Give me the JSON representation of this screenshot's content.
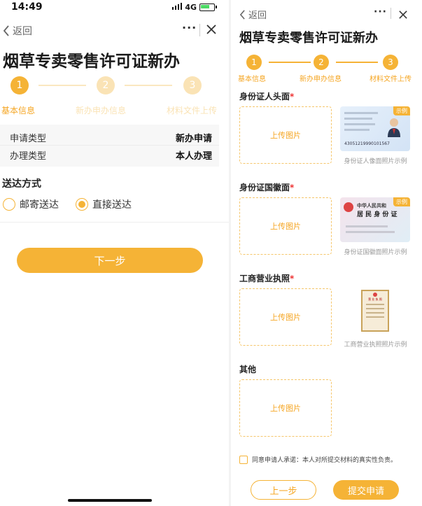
{
  "status_bar": {
    "time": "14:49",
    "network": "4G"
  },
  "nav": {
    "back_label": "返回"
  },
  "page_title": "烟草专卖零售许可证新办",
  "steps": [
    {
      "number": "1",
      "label": "基本信息"
    },
    {
      "number": "2",
      "label": "新办申办信息"
    },
    {
      "number": "3",
      "label": "材料文件上传"
    }
  ],
  "info": [
    {
      "key": "申请类型",
      "value": "新办申请"
    },
    {
      "key": "办理类型",
      "value": "本人办理"
    }
  ],
  "delivery": {
    "title": "送达方式",
    "options": [
      "邮寄送达",
      "直接送达"
    ],
    "selected": "直接送达"
  },
  "next_button": "下一步",
  "uploads": [
    {
      "label": "身份证人头面",
      "required_mark": "*",
      "upload_text": "上传图片",
      "sample_caption": "身份证人像面照片示例",
      "badge": "示例"
    },
    {
      "label": "身份证国徽面",
      "required_mark": "*",
      "upload_text": "上传图片",
      "sample_caption": "身份证国徽面照片示例",
      "badge": "示例"
    },
    {
      "label": "工商营业执照",
      "required_mark": "*",
      "upload_text": "上传图片",
      "sample_caption": "工商营业执照照片示例"
    },
    {
      "label": "其他",
      "upload_text": "上传图片"
    }
  ],
  "sample_text": {
    "id_number": "43051219990101567",
    "emblem_line1": "中华人民共和",
    "emblem_line2": "居 民 身 份 证",
    "license_title": "营 业 执 照"
  },
  "agreement": "同意申请人承诺：本人对所提交材料的真实性负责。",
  "prev_button": "上一步",
  "submit_button": "提交申请",
  "colors": {
    "accent": "#f5b336",
    "accent_text": "#f5a623",
    "required": "#e33333"
  }
}
